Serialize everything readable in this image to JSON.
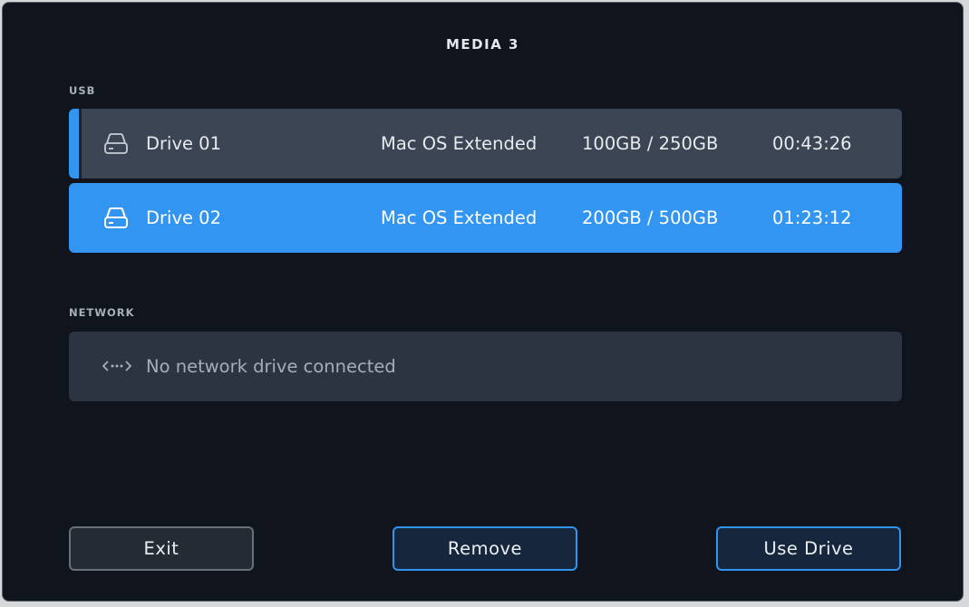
{
  "dialog": {
    "title": "MEDIA 3"
  },
  "usb": {
    "label": "USB",
    "drives": [
      {
        "name": "Drive 01",
        "format": "Mac OS Extended",
        "usage": "100GB / 250GB",
        "time": "00:43:26",
        "icon": "drive-icon"
      },
      {
        "name": "Drive 02",
        "format": "Mac OS Extended",
        "usage": "200GB / 500GB",
        "time": "01:23:12",
        "icon": "drive-icon"
      }
    ]
  },
  "network": {
    "label": "NETWORK",
    "message": "No network drive connected",
    "icon": "network-icon"
  },
  "buttons": {
    "exit": "Exit",
    "remove": "Remove",
    "use_drive": "Use Drive"
  },
  "colors": {
    "accent": "#3395f2",
    "row_bg": "#3b4553",
    "background": "#0f141d"
  }
}
